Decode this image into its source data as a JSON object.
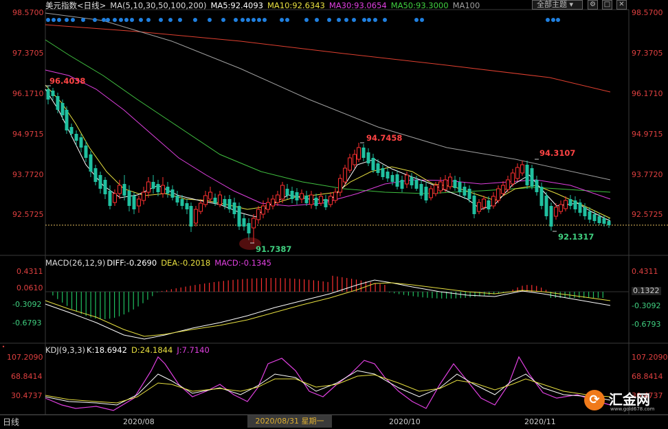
{
  "header": {
    "title": "美元指数<日线>",
    "ma_params": "MA(5,10,30,50,100,200)",
    "ma5": "MA5:92.4093",
    "ma10": "MA10:92.6343",
    "ma30": "MA30:93.0654",
    "ma50": "MA50:93.3000",
    "ma100": "MA100",
    "theme_select": "全部主题",
    "colors": {
      "title": "#e0e0e0",
      "ma5": "#ffffff",
      "ma10": "#e8e040",
      "ma30": "#e040e0",
      "ma50": "#40d040",
      "ma100": "#a0a0a0"
    }
  },
  "price_axis": {
    "left": [
      "98.5700",
      "97.3705",
      "96.1710",
      "94.9715",
      "93.7720",
      "92.5725"
    ],
    "right": [
      "98.5700",
      "97.3705",
      "96.1710",
      "94.9715",
      "93.7720",
      "92.5725"
    ]
  },
  "annotations": {
    "high1": "96.4038",
    "high2": "94.7458",
    "high3": "94.3107",
    "low1": "91.7387",
    "low2": "92.1317"
  },
  "macd": {
    "label": "MACD(26,12,9)",
    "diff": "DIFF:-0.2690",
    "dea": "DEA:-0.2018",
    "macd": "MACD:-0.1345",
    "axis_left": [
      "0.4311",
      "0.0610",
      "-0.3092",
      "-0.6793"
    ],
    "axis_right": [
      "0.4311",
      "0.1322",
      "-0.3092",
      "-0.6793"
    ]
  },
  "kdj": {
    "label": "KDJ(9,3,3)",
    "k": "K:18.6942",
    "d": "D:24.1844",
    "j": "J:7.7140",
    "axis_left": [
      "107.2090",
      "68.8414",
      "30.4737"
    ],
    "axis_right": [
      "107.2090",
      "68.8414",
      "30.4737"
    ]
  },
  "time_axis": {
    "timeframe": "日线",
    "labels": [
      "2020/08",
      "2020/10",
      "2020/11"
    ],
    "cursor_date": "2020/08/31 星期一"
  },
  "watermark": {
    "name": "汇金网",
    "url": "www.gold678.com"
  }
}
